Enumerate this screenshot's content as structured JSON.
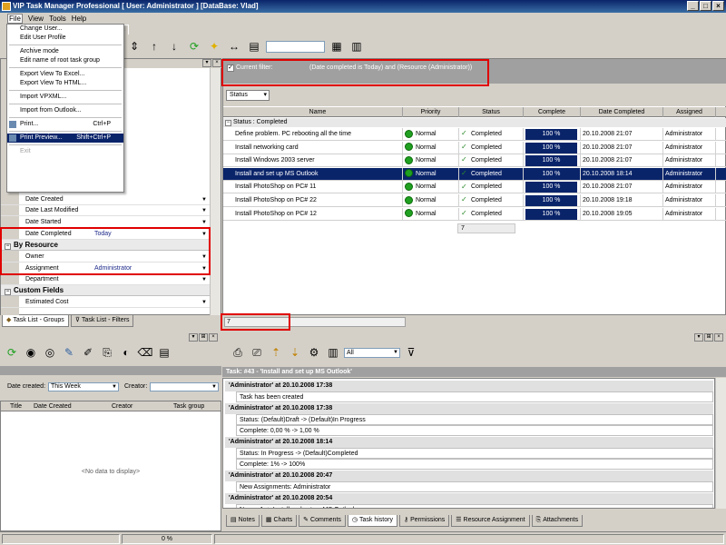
{
  "window": {
    "title": "VIP Task Manager Professional [ User: Administrator ] [DataBase: Vlad]",
    "buttons": [
      "_",
      "□",
      "×"
    ]
  },
  "menu_bar": [
    "File",
    "View",
    "Tools",
    "Help"
  ],
  "top_tab": "ce List",
  "file_menu": {
    "items": [
      {
        "label": "Change User..."
      },
      {
        "label": "Edit User Profile"
      },
      {
        "sep": true
      },
      {
        "label": "Archive mode"
      },
      {
        "label": "Edit name of root task group"
      },
      {
        "sep": true
      },
      {
        "label": "Export View To Excel..."
      },
      {
        "label": "Export View To HTML..."
      },
      {
        "sep": true
      },
      {
        "label": "Import VPXML..."
      },
      {
        "sep": true
      },
      {
        "label": "Import from Outlook..."
      },
      {
        "sep": true
      },
      {
        "label": "Print...",
        "shortcut": "Ctrl+P"
      },
      {
        "sep": true
      },
      {
        "label": "Print Preview...",
        "shortcut": "Shift+Ctrl+P",
        "selected": true
      },
      {
        "sep": true
      },
      {
        "label": "Exit",
        "disabled": true
      }
    ]
  },
  "properties": {
    "rows": [
      {
        "name": "Date Created",
        "value": ""
      },
      {
        "name": "Date Last Modified",
        "value": ""
      },
      {
        "name": "Date Started",
        "value": ""
      },
      {
        "name": "Date Completed",
        "value": "Today"
      }
    ],
    "by_resource": {
      "label": "By Resource",
      "rows": [
        {
          "name": "Owner",
          "value": ""
        },
        {
          "name": "Assignment",
          "value": "Administrator"
        },
        {
          "name": "Department",
          "value": ""
        }
      ]
    },
    "custom_fields": {
      "label": "Custom Fields",
      "rows": [
        {
          "name": "Estimated Cost",
          "value": ""
        }
      ]
    }
  },
  "left_tabs": [
    "Task List - Groups",
    "Task List - Filters"
  ],
  "filter": {
    "label": "Current filter:",
    "value": "(Date completed is Today) and (Resource  (Administrator))"
  },
  "group_chip": "Status",
  "grid": {
    "columns": [
      "Name",
      "Priority",
      "Status",
      "Complete",
      "Date Completed",
      "Assigned"
    ],
    "group_label": "Status : Completed",
    "rows": [
      {
        "name": "Define problem. PC rebooting all the time",
        "priority": "Normal",
        "status": "Completed",
        "complete": "100 %",
        "date": "20.10.2008 21:07",
        "assigned": "Administrator",
        "selected": false
      },
      {
        "name": "Install networking card",
        "priority": "Normal",
        "status": "Completed",
        "complete": "100 %",
        "date": "20.10.2008 21:07",
        "assigned": "Administrator",
        "selected": false
      },
      {
        "name": "Install Windows 2003 server",
        "priority": "Normal",
        "status": "Completed",
        "complete": "100 %",
        "date": "20.10.2008 21:07",
        "assigned": "Administrator",
        "selected": false
      },
      {
        "name": "Install and set up MS Outlook",
        "priority": "Normal",
        "status": "Completed",
        "complete": "100 %",
        "date": "20.10.2008 18:14",
        "assigned": "Administrator",
        "selected": true
      },
      {
        "name": "Install PhotoShop on PC# 11",
        "priority": "Normal",
        "status": "Completed",
        "complete": "100 %",
        "date": "20.10.2008 21:07",
        "assigned": "Administrator",
        "selected": false
      },
      {
        "name": "Install PhotoShop on PC# 22",
        "priority": "Normal",
        "status": "Completed",
        "complete": "100 %",
        "date": "20.10.2008 19:18",
        "assigned": "Administrator",
        "selected": false
      },
      {
        "name": "Install PhotoShop on PC# 12",
        "priority": "Normal",
        "status": "Completed",
        "complete": "100 %",
        "date": "20.10.2008 19:05",
        "assigned": "Administrator",
        "selected": false
      }
    ],
    "group_count": "7",
    "total_count": "7"
  },
  "bottom_left": {
    "date_created_label": "Date created:",
    "date_created_value": "This Week",
    "creator_label": "Creator:",
    "creator_value": "",
    "columns": [
      "Title",
      "Date Created",
      "Creator",
      "Task group"
    ],
    "empty_text": "<No data to display>"
  },
  "bottom_right": {
    "combo_value": "All",
    "task_title": "Task: #43 - 'Install and set up MS Outlook'",
    "history": [
      {
        "header": "'Administrator' at 20.10.2008 17:38",
        "lines": [
          "Task has been created"
        ]
      },
      {
        "header": "'Administrator' at 20.10.2008 17:38",
        "lines": [
          "Status: (Default)Draft -> (Default)In Progress",
          "Complete: 0,00 % -> 1,00 %"
        ]
      },
      {
        "header": "'Administrator' at 20.10.2008 18:14",
        "lines": [
          "Status: In Progress -> (Default)Completed",
          "Complete: 1% -> 100%"
        ]
      },
      {
        "header": "'Administrator' at 20.10.2008 20:47",
        "lines": [
          "New Assignments: Administrator"
        ]
      },
      {
        "header": "'Administrator' at 20.10.2008 20:54",
        "lines": [
          "Name: 1 -> Install and set up MS Outlook"
        ]
      }
    ],
    "tabs": [
      "Notes",
      "Charts",
      "Comments",
      "Task history",
      "Permissions",
      "Resource Assignment",
      "Attachments"
    ]
  },
  "status_bar": {
    "progress": "0 %"
  }
}
